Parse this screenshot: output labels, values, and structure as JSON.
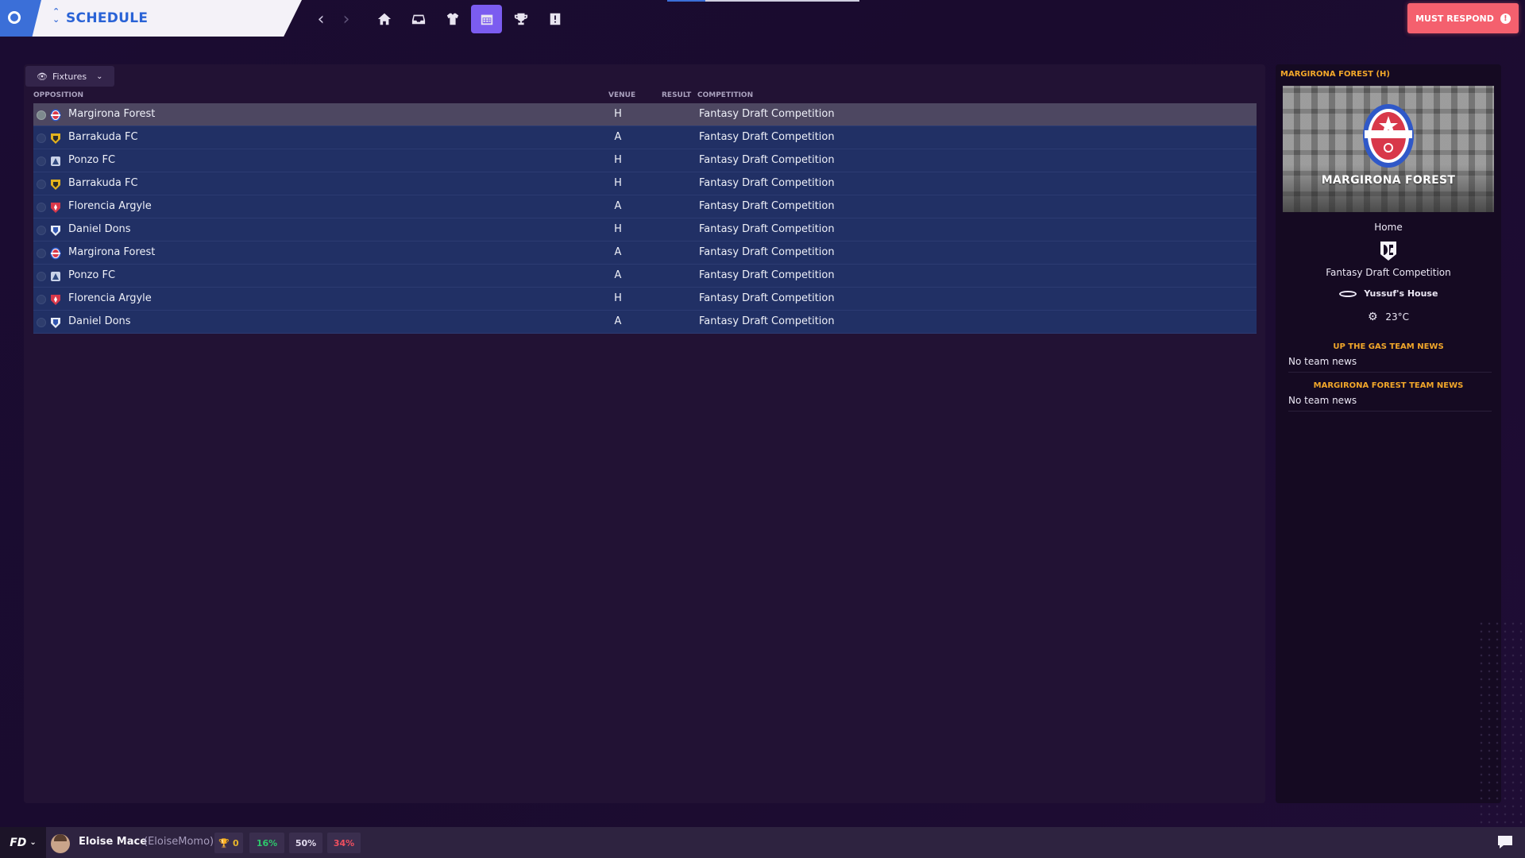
{
  "header": {
    "title": "SCHEDULE",
    "must_respond_label": "MUST RESPOND",
    "must_respond_icon": "!",
    "nav_icons": [
      "home-icon",
      "inbox-icon",
      "squad-shirt-icon",
      "calendar-icon",
      "trophy-icon",
      "info-icon"
    ],
    "active_nav": "calendar-icon",
    "top_progress_fraction": 0.2
  },
  "filter": {
    "label": "Fixtures"
  },
  "columns": {
    "opposition": "OPPOSITION",
    "venue": "VENUE",
    "result": "RESULT",
    "competition": "COMPETITION"
  },
  "fixtures": [
    {
      "team": "Margirona Forest",
      "venue": "H",
      "result": "",
      "competition": "Fantasy Draft Competition",
      "crest": "margirona-crest-icon",
      "selected": true
    },
    {
      "team": "Barrakuda FC",
      "venue": "A",
      "result": "",
      "competition": "Fantasy Draft Competition",
      "crest": "barrakuda-crest-icon",
      "selected": false
    },
    {
      "team": "Ponzo FC",
      "venue": "H",
      "result": "",
      "competition": "Fantasy Draft Competition",
      "crest": "ponzo-crest-icon",
      "selected": false
    },
    {
      "team": "Barrakuda FC",
      "venue": "H",
      "result": "",
      "competition": "Fantasy Draft Competition",
      "crest": "barrakuda-crest-icon",
      "selected": false
    },
    {
      "team": "Florencia Argyle",
      "venue": "A",
      "result": "",
      "competition": "Fantasy Draft Competition",
      "crest": "florencia-crest-icon",
      "selected": false
    },
    {
      "team": "Daniel Dons",
      "venue": "H",
      "result": "",
      "competition": "Fantasy Draft Competition",
      "crest": "daniel-dons-crest-icon",
      "selected": false
    },
    {
      "team": "Margirona Forest",
      "venue": "A",
      "result": "",
      "competition": "Fantasy Draft Competition",
      "crest": "margirona-crest-icon",
      "selected": false
    },
    {
      "team": "Ponzo FC",
      "venue": "A",
      "result": "",
      "competition": "Fantasy Draft Competition",
      "crest": "ponzo-crest-icon",
      "selected": false
    },
    {
      "team": "Florencia Argyle",
      "venue": "H",
      "result": "",
      "competition": "Fantasy Draft Competition",
      "crest": "florencia-crest-icon",
      "selected": false
    },
    {
      "team": "Daniel Dons",
      "venue": "A",
      "result": "",
      "competition": "Fantasy Draft Competition",
      "crest": "daniel-dons-crest-icon",
      "selected": false
    }
  ],
  "detail": {
    "title": "MARGIRONA FOREST (H)",
    "club_name": "MARGIRONA FOREST",
    "venue_label": "Home",
    "competition": "Fantasy Draft Competition",
    "stadium": "Yussuf's House",
    "weather": "23°C",
    "team_news_1_title": "UP THE GAS TEAM NEWS",
    "team_news_1_text": "No team news",
    "team_news_2_title": "MARGIRONA FOREST TEAM NEWS",
    "team_news_2_text": "No team news"
  },
  "footer": {
    "logo": "FD",
    "user_name": "Eloise Mace",
    "user_handle": "(EloiseMomo)",
    "trophies": "0",
    "win_pct": "16%",
    "draw_pct": "50%",
    "loss_pct": "34%"
  },
  "colors": {
    "accent_purple": "#7b5cf0",
    "accent_blue": "#3b6fd8",
    "alert_red": "#f4606e",
    "orange_heading": "#f2a72a",
    "row_blue": "#213065",
    "win_green": "#2ec86c",
    "loss_red": "#ef4f5f"
  }
}
